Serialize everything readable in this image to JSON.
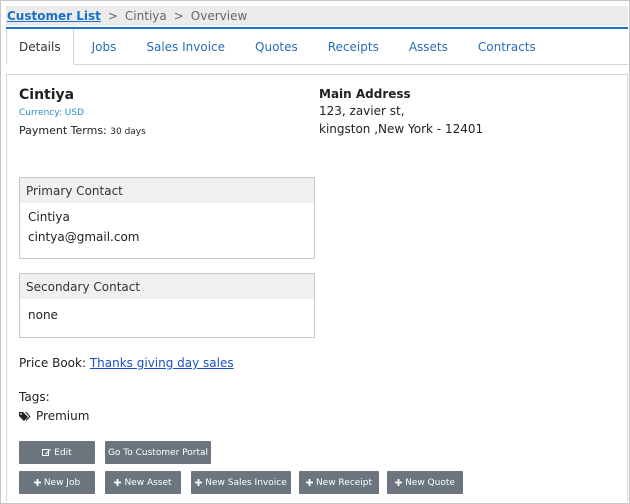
{
  "breadcrumb": {
    "root": "Customer List",
    "customer": "Cintiya",
    "current": "Overview",
    "separator": ">"
  },
  "tabs": [
    {
      "label": "Details",
      "active": true
    },
    {
      "label": "Jobs"
    },
    {
      "label": "Sales Invoice"
    },
    {
      "label": "Quotes"
    },
    {
      "label": "Receipts"
    },
    {
      "label": "Assets"
    },
    {
      "label": "Contracts"
    }
  ],
  "customer": {
    "name": "Cintiya",
    "currency": "Currency: USD",
    "payment_terms_label": "Payment Terms:",
    "payment_terms_value": "30 days"
  },
  "address": {
    "title": "Main Address",
    "line1": "123, zavier st,",
    "line2": "kingston ,New York - 12401"
  },
  "primary_contact": {
    "title": "Primary Contact",
    "name": "Cintiya",
    "email": "cintya@gmail.com"
  },
  "secondary_contact": {
    "title": "Secondary Contact",
    "value": "none"
  },
  "price_book": {
    "label": "Price Book:",
    "value": "Thanks giving day sales"
  },
  "tags": {
    "label": "Tags:",
    "items": [
      "Premium"
    ]
  },
  "buttons": {
    "edit": "Edit",
    "portal": "Go To Customer Portal",
    "new_job": "New Job",
    "new_asset": "New Asset",
    "new_sales_invoice": "New Sales Invoice",
    "new_receipt": "New Receipt",
    "new_quote": "New Quote"
  },
  "colors": {
    "accent": "#1a73c9",
    "link": "#1a6fc9",
    "button": "#6c757d"
  },
  "icons": {
    "edit": "edit-icon",
    "plus": "plus-icon",
    "tag": "tags-icon"
  }
}
